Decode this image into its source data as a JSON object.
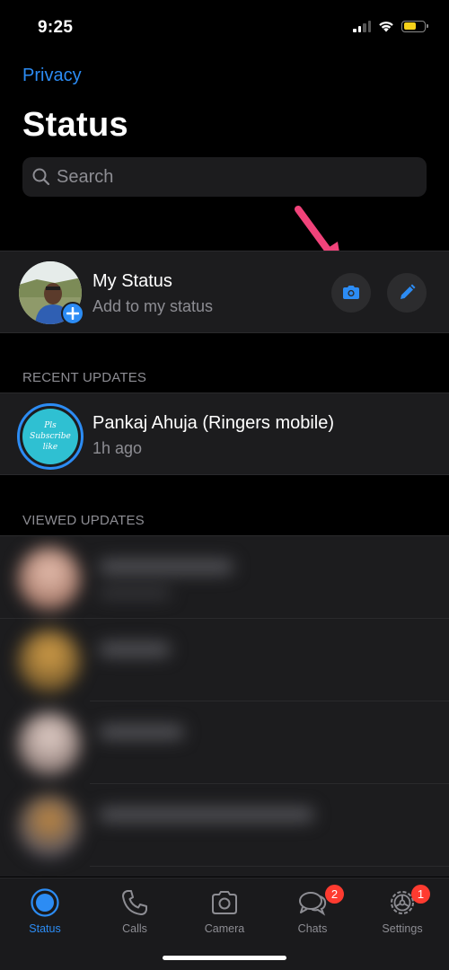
{
  "status_bar": {
    "time": "9:25"
  },
  "nav": {
    "back_label": "Privacy",
    "title": "Status"
  },
  "search": {
    "placeholder": "Search"
  },
  "my_status": {
    "name": "My Status",
    "subtitle": "Add to my status"
  },
  "sections": {
    "recent": "RECENT UPDATES",
    "viewed": "VIEWED UPDATES"
  },
  "recent_updates": [
    {
      "name": "Pankaj Ahuja (Ringers mobile)",
      "time": "1h ago",
      "thumb_lines": [
        "Pls",
        "Subscribe",
        "like"
      ]
    }
  ],
  "tabs": [
    {
      "label": "Status",
      "icon": "status-icon",
      "active": true
    },
    {
      "label": "Calls",
      "icon": "phone-icon"
    },
    {
      "label": "Camera",
      "icon": "camera-icon"
    },
    {
      "label": "Chats",
      "icon": "chat-bubbles-icon",
      "badge": "2"
    },
    {
      "label": "Settings",
      "icon": "gear-icon",
      "badge": "1"
    }
  ],
  "colors": {
    "accent": "#2c8cf4",
    "annotation_arrow": "#f0437a",
    "badge": "#ff3b30",
    "cell": "#1c1c1e"
  }
}
